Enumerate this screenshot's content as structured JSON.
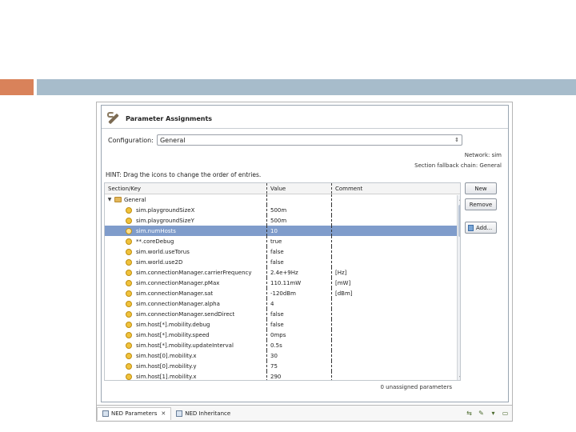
{
  "page": {
    "title": "Parameter Assignments",
    "configuration_label": "Configuration:",
    "configuration_value": "General",
    "network": "Network: sim",
    "fallback_chain": "Section fallback chain: General",
    "hint": "HINT: Drag the icons to change the order of entries.",
    "unassigned": "0 unassigned parameters"
  },
  "table": {
    "headers": {
      "key": "Section/Key",
      "value": "Value",
      "comment": "Comment"
    },
    "section": "General",
    "rows": [
      {
        "key": "sim.playgroundSizeX",
        "value": "500m",
        "comment": ""
      },
      {
        "key": "sim.playgroundSizeY",
        "value": "500m",
        "comment": ""
      },
      {
        "key": "sim.numHosts",
        "value": "10",
        "comment": ""
      },
      {
        "key": "**.coreDebug",
        "value": "true",
        "comment": ""
      },
      {
        "key": "sim.world.useTorus",
        "value": "false",
        "comment": ""
      },
      {
        "key": "sim.world.use2D",
        "value": "false",
        "comment": ""
      },
      {
        "key": "sim.connectionManager.carrierFrequency",
        "value": "2.4e+9Hz",
        "comment": "[Hz]"
      },
      {
        "key": "sim.connectionManager.pMax",
        "value": "110.11mW",
        "comment": "[mW]"
      },
      {
        "key": "sim.connectionManager.sat",
        "value": "-120dBm",
        "comment": "[dBm]"
      },
      {
        "key": "sim.connectionManager.alpha",
        "value": "4",
        "comment": ""
      },
      {
        "key": "sim.connectionManager.sendDirect",
        "value": "false",
        "comment": ""
      },
      {
        "key": "sim.host[*].mobility.debug",
        "value": "false",
        "comment": ""
      },
      {
        "key": "sim.host[*].mobility.speed",
        "value": "0mps",
        "comment": ""
      },
      {
        "key": "sim.host[*].mobility.updateInterval",
        "value": "0.5s",
        "comment": ""
      },
      {
        "key": "sim.host[0].mobility.x",
        "value": "30",
        "comment": ""
      },
      {
        "key": "sim.host[0].mobility.y",
        "value": "75",
        "comment": ""
      },
      {
        "key": "sim.host[1].mobility.x",
        "value": "290",
        "comment": ""
      }
    ],
    "selected_index": 2
  },
  "buttons": {
    "new": "New",
    "remove": "Remove",
    "add": "Add..."
  },
  "tabs": [
    {
      "label": "NED Parameters"
    },
    {
      "label": "NED Inheritance"
    }
  ],
  "icons": {
    "title": "wrench-icon",
    "section": "folder-icon",
    "param": "parameter-icon"
  },
  "colors": {
    "accent_orange": "#d9825a",
    "accent_blue": "#a7bccb",
    "selection": "#7f9ccb"
  }
}
